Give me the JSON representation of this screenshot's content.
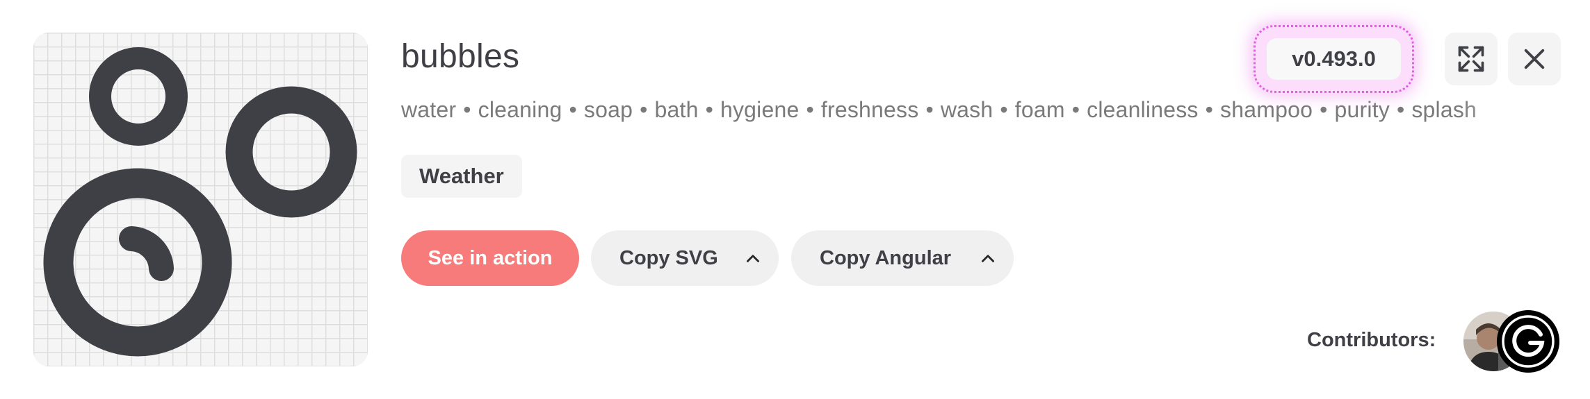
{
  "icon": {
    "name": "bubbles",
    "tags": [
      "water",
      "cleaning",
      "soap",
      "bath",
      "hygiene",
      "freshness",
      "wash",
      "foam",
      "cleanliness",
      "shampoo",
      "purity",
      "splash"
    ],
    "separator": "•",
    "category": "Weather",
    "preview_icon": "bubbles-icon"
  },
  "header": {
    "version": "v0.493.0",
    "fullscreen_icon": "expand-icon",
    "close_icon": "close-icon"
  },
  "actions": {
    "see_in_action": "See in action",
    "copy_svg": "Copy SVG",
    "copy_angular": "Copy Angular",
    "chevron_icon": "chevron-up-icon"
  },
  "contributors": {
    "label": "Contributors:",
    "avatars": [
      "person-avatar",
      "logo-avatar"
    ]
  },
  "colors": {
    "primary_button": "#f87b7b",
    "icon_stroke": "#3f3f46",
    "version_highlight": "#e65ce6"
  }
}
